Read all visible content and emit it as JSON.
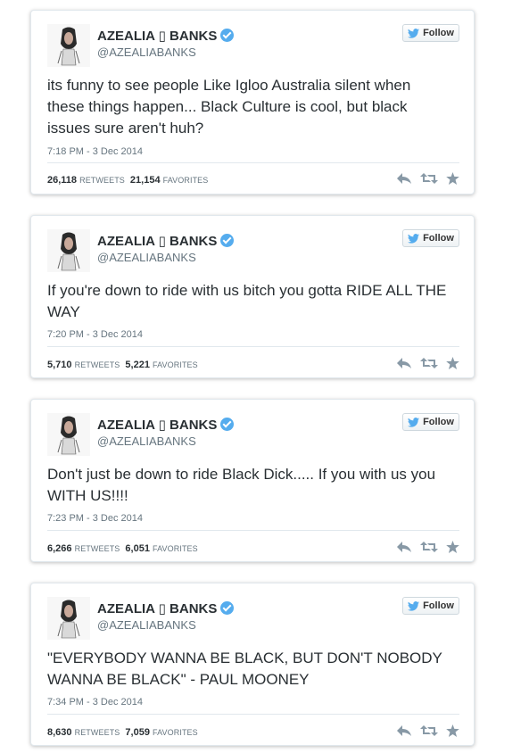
{
  "accent_color": "#55acee",
  "tweets": [
    {
      "name": "AZEALIA ▯ BANKS",
      "handle": "@AZEALIABANKS",
      "follow_label": "Follow",
      "text": "its funny to see people Like Igloo Australia silent when these things happen... Black Culture is cool, but black issues sure aren't huh?",
      "timestamp": "7:18 PM - 3 Dec 2014",
      "retweets": "26,118",
      "retweets_label": "RETWEETS",
      "favorites": "21,154",
      "favorites_label": "FAVORITES"
    },
    {
      "name": "AZEALIA ▯ BANKS",
      "handle": "@AZEALIABANKS",
      "follow_label": "Follow",
      "text": "If you're down to ride with us bitch you gotta RIDE ALL THE WAY",
      "timestamp": "7:20 PM - 3 Dec 2014",
      "retweets": "5,710",
      "retweets_label": "RETWEETS",
      "favorites": "5,221",
      "favorites_label": "FAVORITES"
    },
    {
      "name": "AZEALIA ▯ BANKS",
      "handle": "@AZEALIABANKS",
      "follow_label": "Follow",
      "text": "Don't just be down to ride Black Dick..... If you with us you WITH US!!!!",
      "timestamp": "7:23 PM - 3 Dec 2014",
      "retweets": "6,266",
      "retweets_label": "RETWEETS",
      "favorites": "6,051",
      "favorites_label": "FAVORITES"
    },
    {
      "name": "AZEALIA ▯ BANKS",
      "handle": "@AZEALIABANKS",
      "follow_label": "Follow",
      "text": "\"EVERYBODY WANNA BE BLACK, BUT DON'T NOBODY WANNA BE BLACK\" - PAUL MOONEY",
      "timestamp": "7:34 PM - 3 Dec 2014",
      "retweets": "8,630",
      "retweets_label": "RETWEETS",
      "favorites": "7,059",
      "favorites_label": "FAVORITES"
    }
  ]
}
